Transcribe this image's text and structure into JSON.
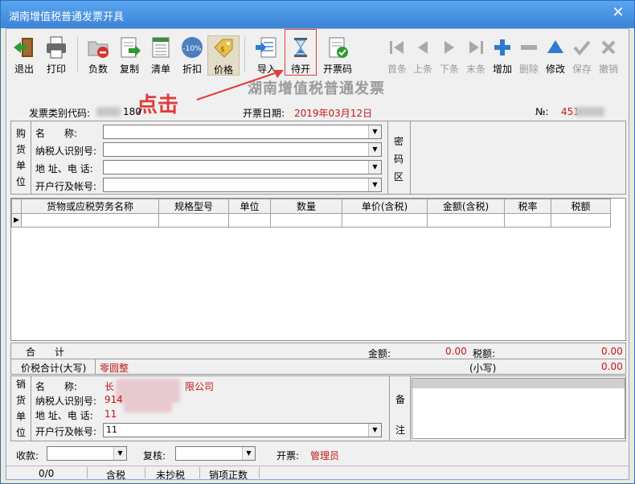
{
  "window": {
    "title": "湖南增值税普通发票开具",
    "close_glyph": "✕"
  },
  "toolbar": {
    "exit": "退出",
    "print": "打印",
    "negative": "负数",
    "copy": "复制",
    "list": "清单",
    "discount": "折扣",
    "price": "价格",
    "import": "导入",
    "pending": "待开",
    "qrcode": "开票码",
    "first": "首条",
    "prev": "上条",
    "next": "下条",
    "last": "末条",
    "add": "增加",
    "delete": "删除",
    "edit": "修改",
    "save": "保存",
    "undo": "撤销",
    "discount_badge": "-10%"
  },
  "annotation": {
    "text": "点击"
  },
  "invoice": {
    "heading": "湖南增值税普通发票",
    "type_code_label": "发票类别代码:",
    "type_code_value": "180",
    "date_label": "开票日期:",
    "date_value": "2019年03月12日",
    "number_label": "№:",
    "number_value": "451"
  },
  "buyer": {
    "section": [
      "购",
      "货",
      "单",
      "位"
    ],
    "name_label": "名　　称:",
    "taxid_label": "纳税人识别号:",
    "address_label": "地 址、电 话:",
    "bank_label": "开户行及帐号:",
    "cipher": [
      "密",
      "码",
      "区"
    ]
  },
  "items_table": {
    "headers": [
      "货物或应税劳务名称",
      "规格型号",
      "单位",
      "数量",
      "单价(含税)",
      "金额(含税)",
      "税率",
      "税额"
    ],
    "row_marker": "▶"
  },
  "totals": {
    "sum_label": "合　　计",
    "amount_label": "金额:",
    "amount_value": "0.00",
    "tax_label": "税额:",
    "tax_value": "0.00",
    "upper_label": "价税合计(大写)",
    "upper_value": "零圆整",
    "lower_label": "(小写)",
    "lower_value": "0.00"
  },
  "seller": {
    "section": [
      "销",
      "货",
      "单",
      "位"
    ],
    "name_label": "名　　称:",
    "name_value_start": "长",
    "name_value_end": "限公司",
    "taxid_label": "纳税人识别号:",
    "taxid_value": "914",
    "address_label": "地 址、电 话:",
    "address_value": "11",
    "bank_label": "开户行及帐号:",
    "bank_value": "11",
    "remarks": [
      "备",
      "注"
    ]
  },
  "signoff": {
    "payee_label": "收款:",
    "reviewer_label": "复核:",
    "issuer_label": "开票:",
    "issuer_value": "管理员"
  },
  "statusbar": {
    "count": "0/0",
    "tax_mode": "含税",
    "copy_status": "未抄税",
    "invoice_kind": "销项正数"
  },
  "colors": {
    "titlebar": "#3b84d6",
    "accent_red": "#c21818",
    "annotation_red": "#e23b3b",
    "page_bg": "#f0f0f0"
  }
}
